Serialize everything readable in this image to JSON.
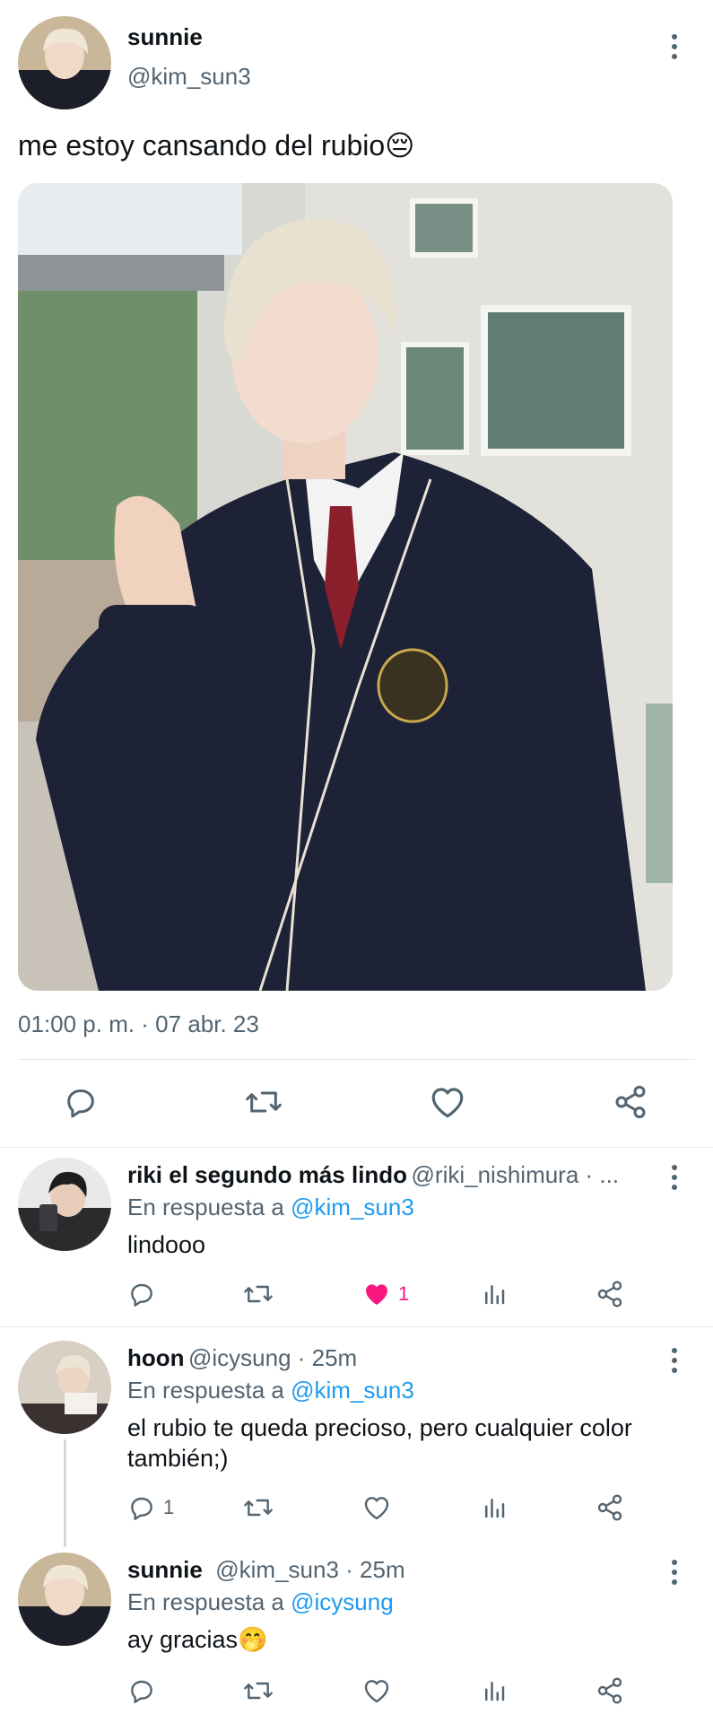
{
  "main_tweet": {
    "display_name": "sunnie",
    "handle": "@kim_sun3",
    "text": "me estoy cansando del rubio",
    "emoji": "😔",
    "timestamp": "01:00 p. m. · 07 abr. 23"
  },
  "replies": [
    {
      "display_name": "riki el segundo más lindo",
      "meta": "@riki_nishimura · ...",
      "reply_prefix": "En respuesta a",
      "reply_to": "@kim_sun3",
      "text": "lindooo",
      "like_count": "1",
      "reply_count": ""
    },
    {
      "display_name": "hoon",
      "meta": "@icysung · 25m",
      "reply_prefix": "En respuesta a",
      "reply_to": "@kim_sun3",
      "text_line1": "el rubio te queda precioso, pero cualquier color",
      "text_line2": "también;)",
      "reply_count": "1"
    },
    {
      "display_name": "sunnie",
      "meta": "@kim_sun3 · 25m",
      "reply_prefix": "En respuesta a",
      "reply_to": "@icysung",
      "text": "ay gracias",
      "emoji": "🤭"
    }
  ],
  "icons": [
    "more-icon",
    "reply-icon",
    "retweet-icon",
    "like-icon",
    "share-icon",
    "analytics-icon"
  ],
  "colors": {
    "link": "#1d9bf0",
    "like": "#f91880",
    "muted": "#536471"
  }
}
